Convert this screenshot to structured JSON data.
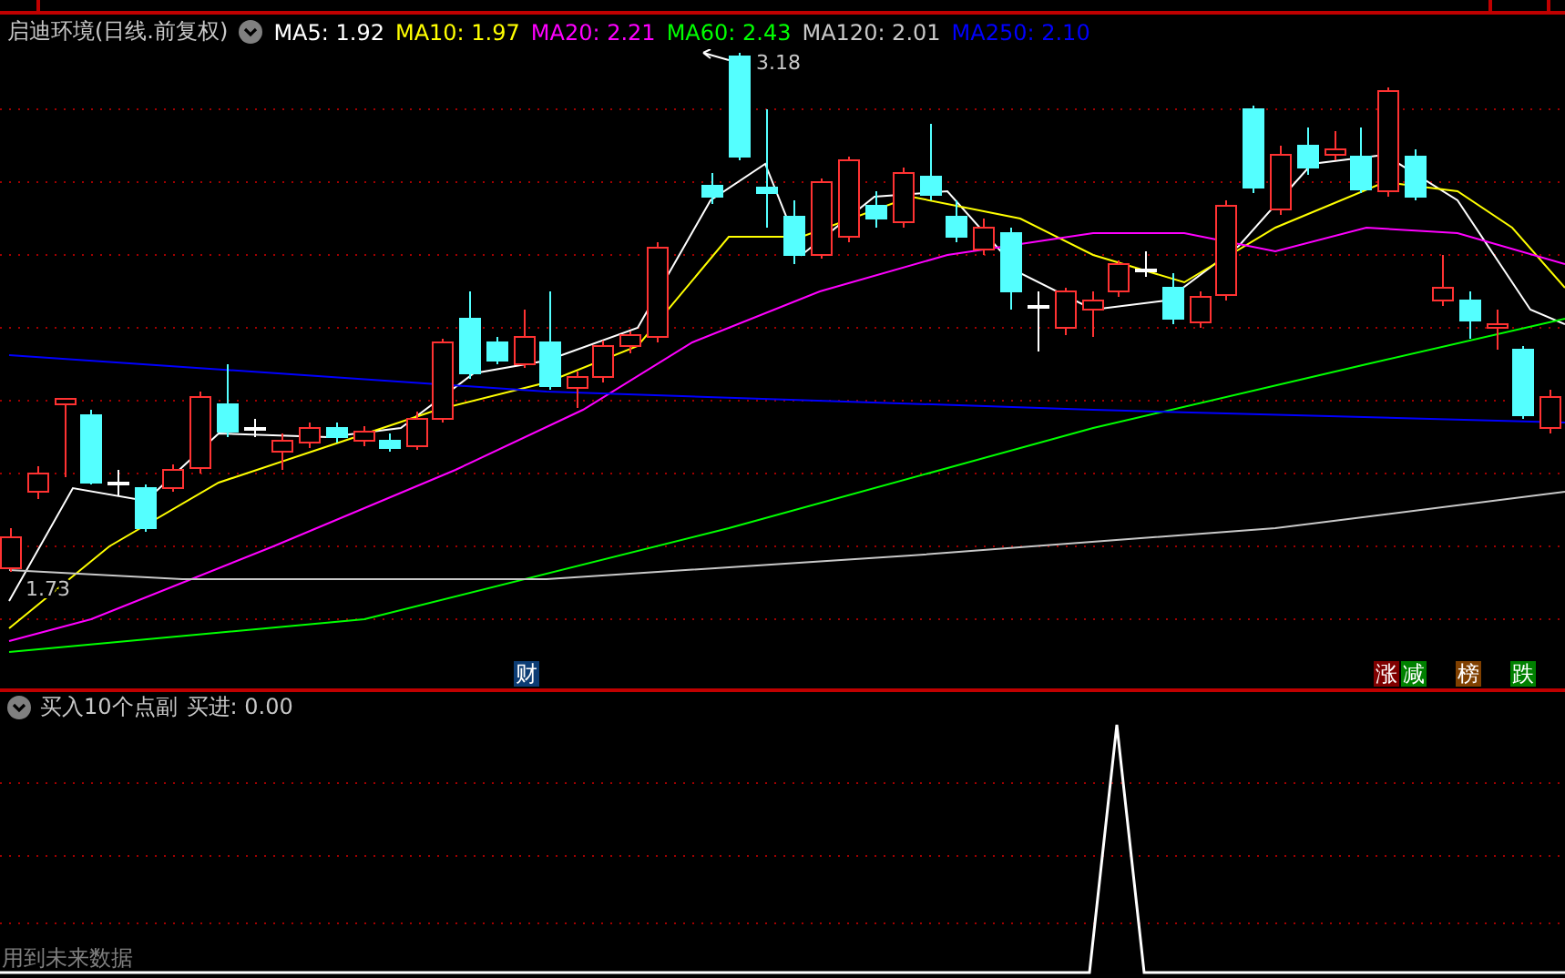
{
  "stock_title": "启迪环境(日线.前复权)",
  "indicators": [
    {
      "label": "MA5: 1.92",
      "color": "#ffffff"
    },
    {
      "label": "MA10: 1.97",
      "color": "#ffff00"
    },
    {
      "label": "MA20: 2.21",
      "color": "#ff00ff"
    },
    {
      "label": "MA60: 2.43",
      "color": "#00ff00"
    },
    {
      "label": "MA120: 2.01",
      "color": "#c8c8c8"
    },
    {
      "label": "MA250: 2.10",
      "color": "#0000ff"
    }
  ],
  "chart_labels": {
    "high": "3.18",
    "low": "1.73"
  },
  "event_markers": [
    {
      "text": "财",
      "color": "#0c3c74"
    },
    {
      "text": "涨",
      "color": "#800000"
    },
    {
      "text": "减",
      "color": "#008000"
    },
    {
      "text": "榜",
      "color": "#804000"
    },
    {
      "text": "跌",
      "color": "#008000"
    }
  ],
  "sub_panel": {
    "title": "买入10个点副",
    "reading": "买进: 0.00"
  },
  "footer_note": "用到未来数据"
}
